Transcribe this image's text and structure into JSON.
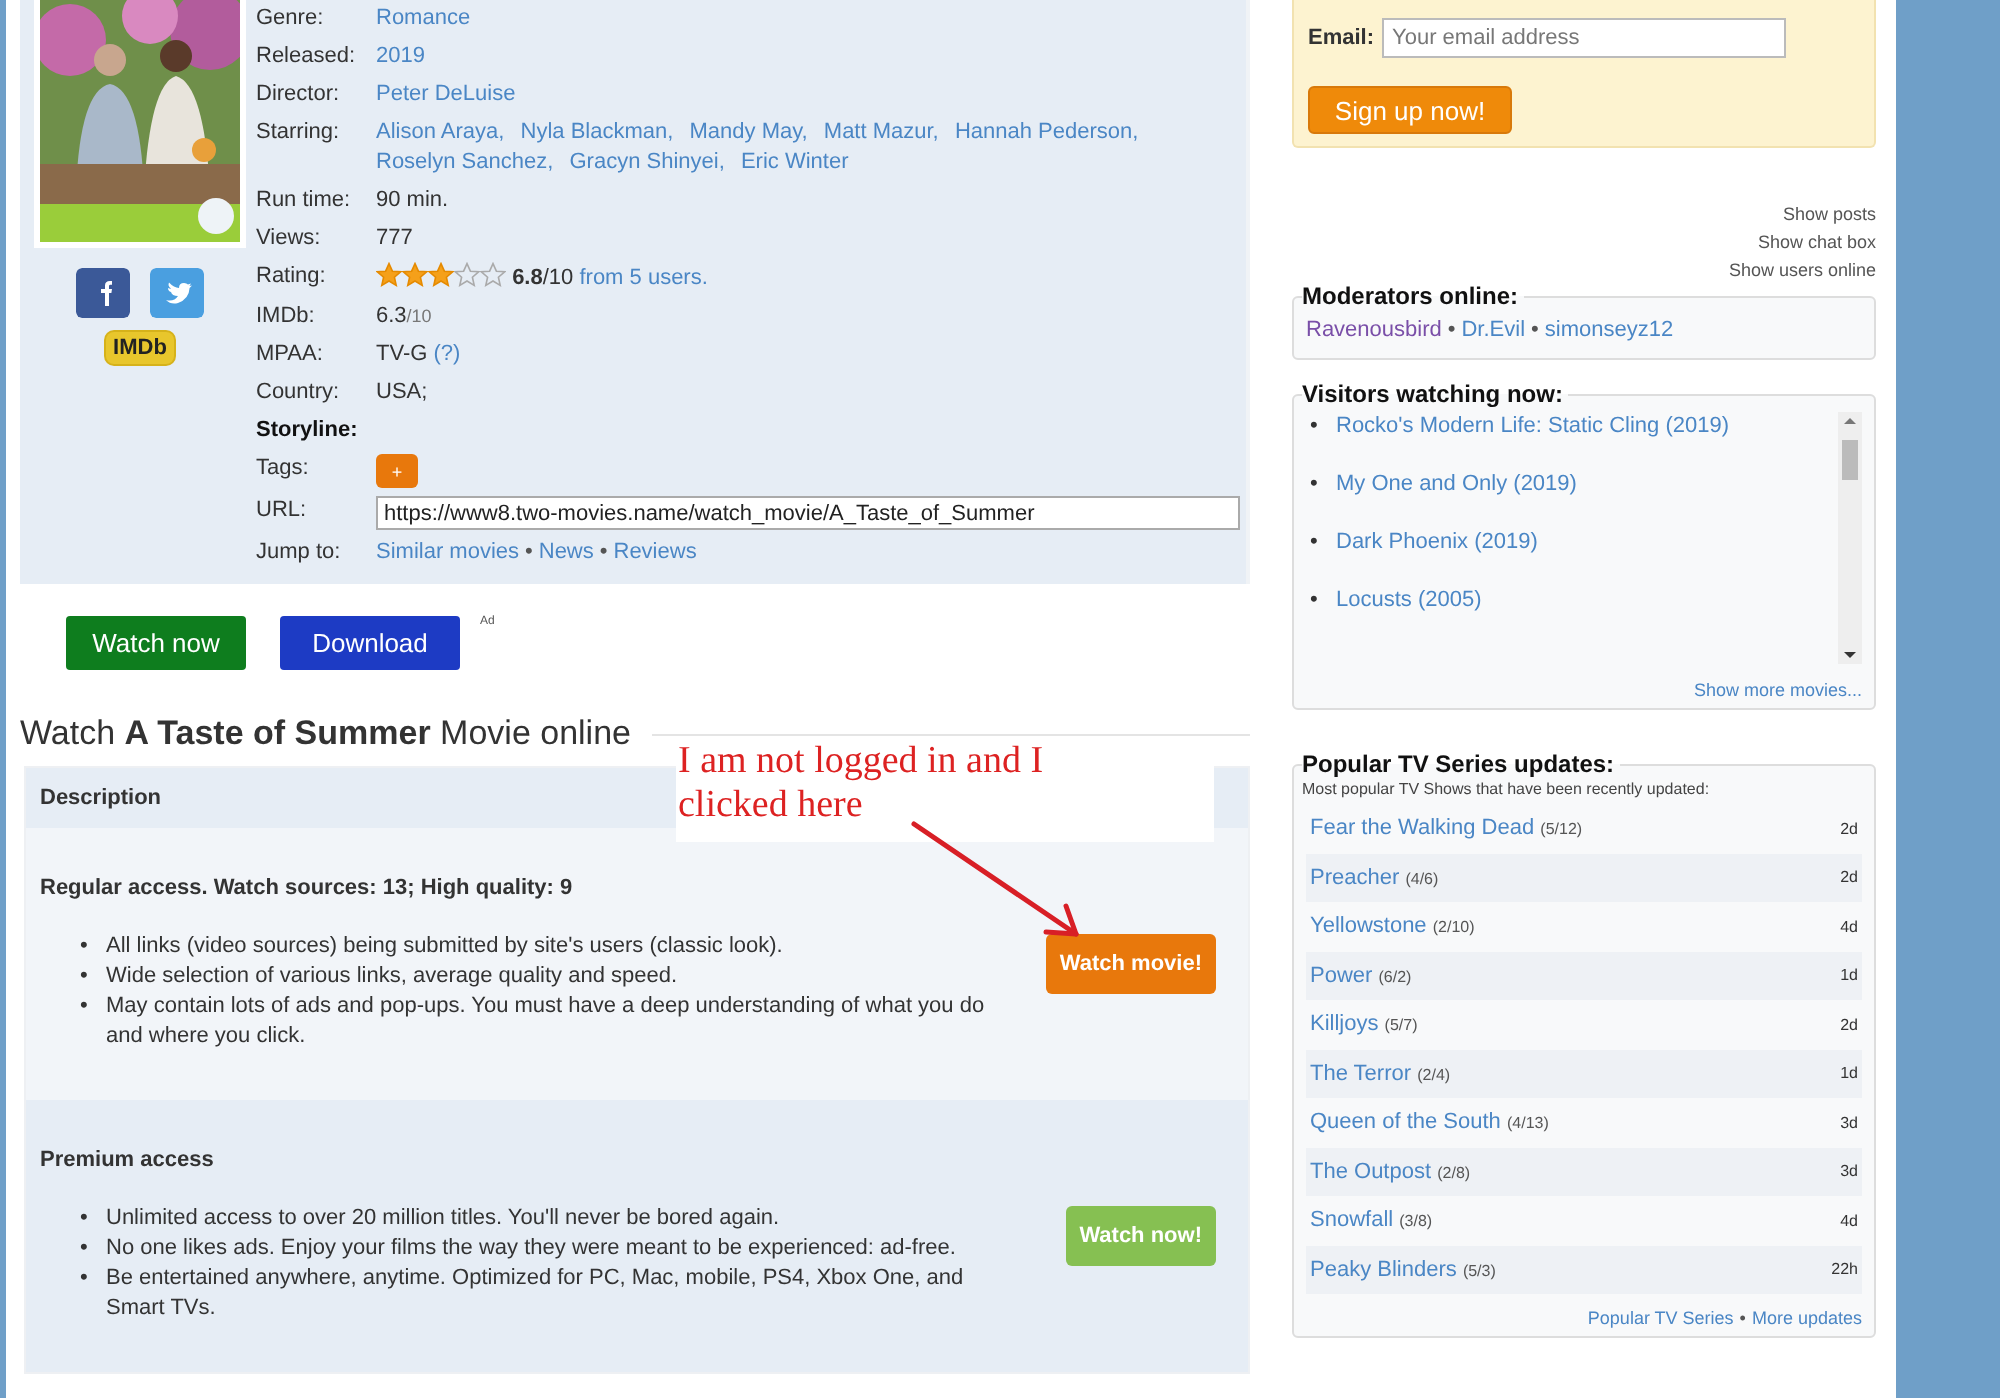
{
  "movie": {
    "share": [
      {
        "kind": "facebook"
      },
      {
        "kind": "twitter"
      }
    ],
    "imdb_badge": "IMDb",
    "details": [
      {
        "label": "Genre:",
        "kind": "links",
        "values": [
          "Romance"
        ]
      },
      {
        "label": "Released:",
        "kind": "links",
        "values": [
          "2019"
        ]
      },
      {
        "label": "Director:",
        "kind": "links",
        "values": [
          "Peter DeLuise"
        ]
      },
      {
        "label": "Starring:",
        "kind": "links",
        "values": [
          "Alison Araya,",
          "Nyla Blackman,",
          "Mandy May,",
          "Matt Mazur,",
          "Hannah Pederson,",
          "Roselyn Sanchez,",
          "Gracyn Shinyei,",
          "Eric Winter"
        ]
      },
      {
        "label": "Run time:",
        "kind": "text",
        "value": "90 min."
      },
      {
        "label": "Views:",
        "kind": "text",
        "value": "777"
      },
      {
        "label": "Rating:",
        "kind": "rating",
        "stars": 3,
        "score": "6.8",
        "suffix": "/10",
        "link": "from 5 users."
      },
      {
        "label": "IMDb:",
        "kind": "score",
        "value": "6.3",
        "suffix": "/10"
      },
      {
        "label": "MPAA:",
        "kind": "text_link",
        "value": "TV-G",
        "link": "(?)"
      },
      {
        "label": "Country:",
        "kind": "text",
        "value": "USA;"
      },
      {
        "label": "Storyline:",
        "kind": "heading"
      },
      {
        "label": "Tags:",
        "kind": "tag",
        "value": "+"
      },
      {
        "label": "URL:",
        "kind": "field",
        "value": "https://www8.two-movies.name/watch_movie/A_Taste_of_Summer"
      },
      {
        "label": "Jump to:",
        "kind": "nav",
        "values": [
          "Similar movies",
          "News",
          "Reviews"
        ],
        "separator": "•"
      }
    ]
  },
  "actions": {
    "buttons": [
      {
        "label": "Watch now",
        "color": "#0e7d1e"
      },
      {
        "label": "Download",
        "color": "#1d3bc4"
      }
    ],
    "ad": "Ad"
  },
  "heading": "Watch **A Taste of Summer** Movie online",
  "description": {
    "header": "Description",
    "bullet": "•",
    "sections": [
      {
        "title": "Regular access. Watch sources: 13; High quality: 9",
        "items": [
          "All links (video sources) being submitted by site's users (classic look).",
          "Wide selection of various links, average quality and speed.",
          "May contain lots of ads and pop-ups. You must have a deep understanding of what you do and where you click."
        ],
        "button": "Watch movie!",
        "color": "#e8780c"
      },
      {
        "title": "Premium access",
        "items": [
          "Unlimited access to over 20 million titles. You'll never be bored again.",
          "No one likes ads. Enjoy your films the way they were meant to be experienced: ad-free.",
          "Be entertained anywhere, anytime. Optimized for PC, Mac, mobile, PS4, Xbox One, and Smart TVs."
        ],
        "button": "Watch now!",
        "color": "#86c052"
      }
    ]
  },
  "annotation": {
    "text": "I am not logged in and I clicked here"
  },
  "sidebar": {
    "signup": {
      "label": "Email:",
      "placeholder": "Your email address",
      "button": "Sign up now!"
    },
    "show_links": [
      "Show posts",
      "Show chat box",
      "Show users online"
    ],
    "moderators": {
      "title": "Moderators online:",
      "separator": "•",
      "names": [
        {
          "name": "Ravenousbird",
          "color": "#7a4fa8"
        },
        {
          "name": "Dr.Evil",
          "color": "#4a86c5"
        },
        {
          "name": "simonseyz12",
          "color": "#4a86c5"
        }
      ]
    },
    "visitors": {
      "title": "Visitors watching now:",
      "bullet": "•",
      "items": [
        "Rocko's Modern Life: Static Cling (2019)",
        "My One and Only (2019)",
        "Dark Phoenix (2019)",
        "Locusts (2005)"
      ],
      "more": "Show more movies..."
    },
    "popular": {
      "title": "Popular TV Series updates:",
      "subtitle": "Most popular TV Shows that have been recently updated:",
      "rows": [
        {
          "title": "Fear the Walking Dead",
          "episode": "(5/12)",
          "age": "2d"
        },
        {
          "title": "Preacher",
          "episode": "(4/6)",
          "age": "2d"
        },
        {
          "title": "Yellowstone",
          "episode": "(2/10)",
          "age": "4d"
        },
        {
          "title": "Power",
          "episode": "(6/2)",
          "age": "1d"
        },
        {
          "title": "Killjoys",
          "episode": "(5/7)",
          "age": "2d"
        },
        {
          "title": "The Terror",
          "episode": "(2/4)",
          "age": "1d"
        },
        {
          "title": "Queen of the South",
          "episode": "(4/13)",
          "age": "3d"
        },
        {
          "title": "The Outpost",
          "episode": "(2/8)",
          "age": "3d"
        },
        {
          "title": "Snowfall",
          "episode": "(3/8)",
          "age": "4d"
        },
        {
          "title": "Peaky Blinders",
          "episode": "(5/3)",
          "age": "22h"
        }
      ],
      "footer": [
        "Popular TV Series",
        "More updates"
      ],
      "separator": "•"
    }
  }
}
